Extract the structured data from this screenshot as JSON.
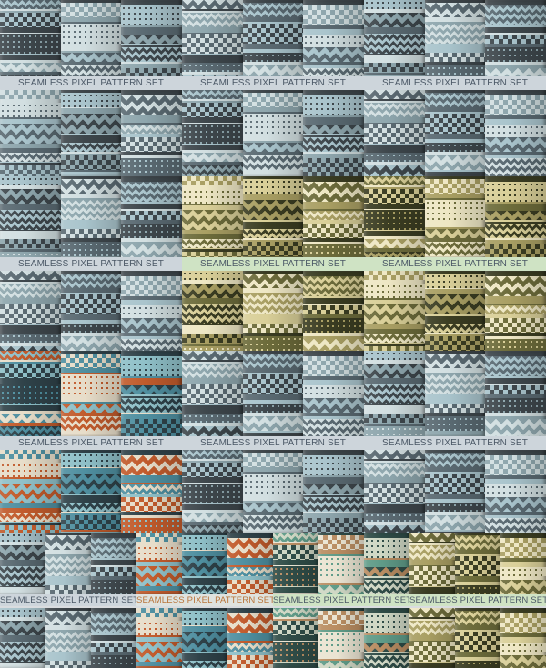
{
  "colors": {
    "slate": [
      "#3e474c",
      "#5a6a72",
      "#8ea6ad",
      "#a9c4cc",
      "#d2dfe1"
    ],
    "olive": [
      "#3b3d22",
      "#6d6c3b",
      "#a99f63",
      "#d9cf98",
      "#eee7c4"
    ],
    "rust": [
      "#2f4249",
      "#c15b2c",
      "#4f8fa0",
      "#8fc0c8",
      "#e7ddc9"
    ],
    "teal": [
      "#2f4c47",
      "#5f9b88",
      "#b98d62",
      "#cfd7c4",
      "#eae4d2"
    ],
    "label_bg_default": "#cdd5db",
    "label_bg_green": "#cfe3c4",
    "label_text": "#4b5866",
    "label_text_orange": "#b9753b"
  },
  "labels": {
    "l1": "SEAMLESS PIXEL PATTERN SET",
    "l2": "SEAMLESS PIXEL PATTERN SET",
    "l3": "SEAMLESS PIXEL PATTERN SET",
    "l4": "SEAMLESS PIXEL PATTERN SET",
    "l5": "SEAMLESS PIXEL PATTERN SET",
    "l6": "SEAMLESS PIXEL PATTERN SET",
    "l7": "SEAMLESS PIXEL PATTERN SET",
    "l8": "SEAMLESS PIXEL PATTERN SET",
    "l9": "SEAMLESS PIXEL PATTERN SET",
    "l10": "SEAMLESS PIXEL PATTERN SET",
    "l11": "SEAMLESS PIXEL PATTERN SET",
    "l12": "SEAMLESS PIXEL PATTERN SET",
    "l13": "SEAMLESS PIXEL PATTERN SET"
  }
}
